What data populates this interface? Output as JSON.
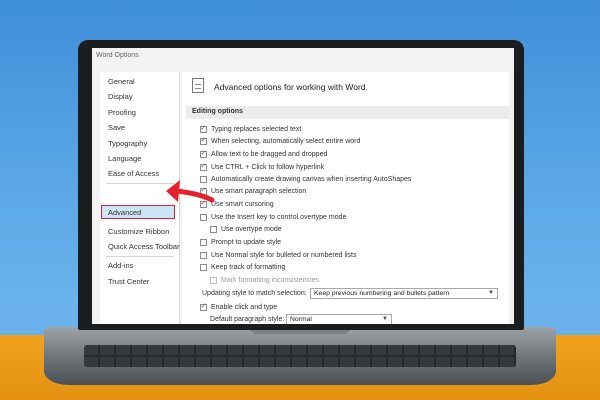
{
  "window": {
    "title": "Word Options"
  },
  "sidebar": {
    "items": [
      "General",
      "Display",
      "Proofing",
      "Save",
      "Typography",
      "Language",
      "Ease of Access",
      "Advanced",
      "Customize Ribbon",
      "Quick Access Toolbar",
      "Add-ins",
      "Trust Center"
    ],
    "selected": "Advanced"
  },
  "main": {
    "heading": "Advanced options for working with Word.",
    "section": "Editing options",
    "options": [
      {
        "label": "Typing replaces selected text",
        "checked": true
      },
      {
        "label": "When selecting, automatically select entire word",
        "checked": true
      },
      {
        "label": "Allow text to be dragged and dropped",
        "checked": true
      },
      {
        "label": "Use CTRL + Click to follow hyperlink",
        "checked": true
      },
      {
        "label": "Automatically create drawing canvas when inserting AutoShapes",
        "checked": false
      },
      {
        "label": "Use smart paragraph selection",
        "checked": true
      },
      {
        "label": "Use smart cursoring",
        "checked": true
      },
      {
        "label": "Use the Insert key to control overtype mode",
        "checked": false
      },
      {
        "label": "Use overtype mode",
        "checked": false
      },
      {
        "label": "Prompt to update style",
        "checked": false
      },
      {
        "label": "Use Normal style for bulleted or numbered lists",
        "checked": false
      },
      {
        "label": "Keep track of formatting",
        "checked": false
      },
      {
        "label": "Mark formatting inconsistencies",
        "checked": false
      },
      {
        "label": "Enable click and type",
        "checked": true
      }
    ],
    "updating_style_label": "Updating style to match selection:",
    "updating_style_value": "Keep previous numbering and bullets pattern",
    "default_paragraph_label": "Default paragraph style:",
    "default_paragraph_value": "Normal"
  },
  "colors": {
    "selected_bg": "#cde3f7",
    "highlight_border": "#d9202b",
    "arrow": "#e4222f"
  }
}
